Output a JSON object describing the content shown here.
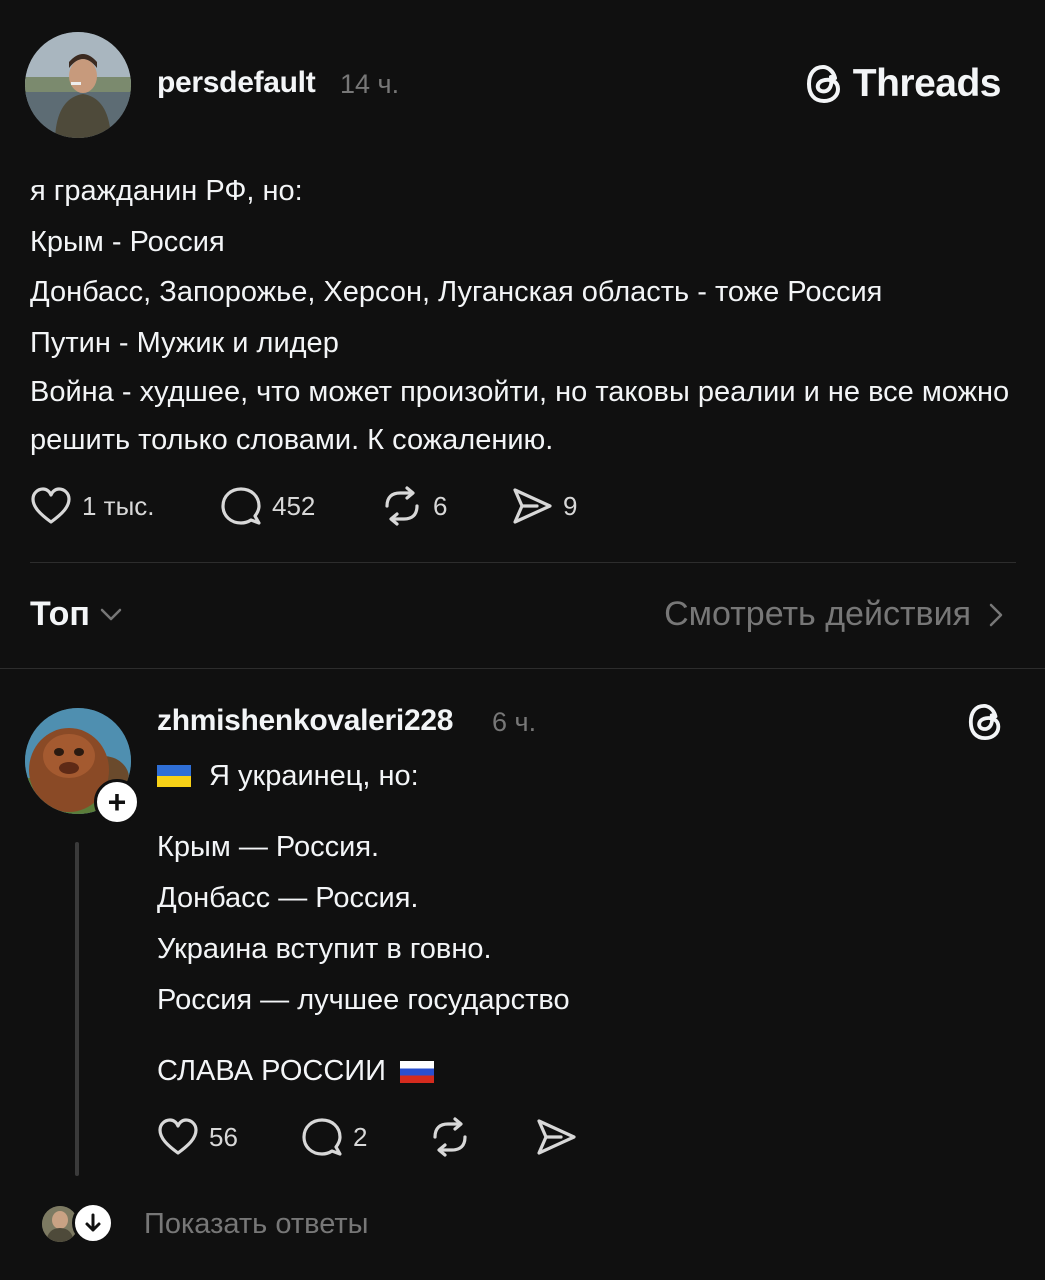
{
  "post": {
    "username": "persdefault",
    "time": "14 ч.",
    "brand": "Threads",
    "lines": [
      "я гражданин РФ, но:",
      "Крым - Россия",
      "Донбасс, Запорожье, Херсон, Луганская область - тоже Россия",
      "Путин - Мужик и лидер",
      "Война - худшее, что может произойти, но таковы реалии и не все можно решить только словами. К сожалению."
    ],
    "likes": "1 тыс.",
    "comments": "452",
    "reposts": "6",
    "shares": "9"
  },
  "sort": {
    "label": "Топ",
    "activity_link": "Смотреть действия"
  },
  "reply": {
    "username": "zhmishenkovaleri228",
    "time": "6 ч.",
    "lines": [
      "Я украинец, но:",
      "Крым — Россия.",
      "Донбасс — Россия.",
      "Украина вступит в говно.",
      "Россия — лучшее государство",
      "СЛАВА РОССИИ"
    ],
    "likes": "56",
    "comments": "2"
  },
  "show_replies": "Показать ответы",
  "colors": {
    "background": "#101010",
    "text": "#f3f5f7",
    "muted": "#777777"
  }
}
